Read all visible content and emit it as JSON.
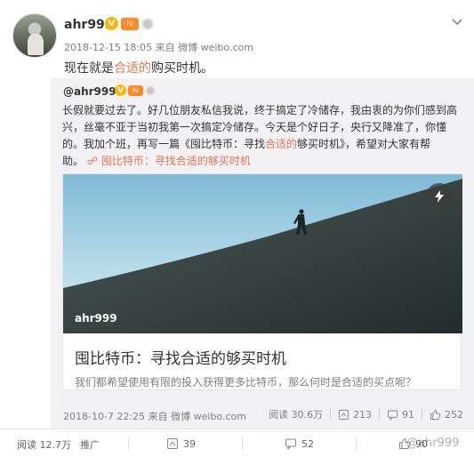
{
  "post": {
    "author": "ahr999",
    "badges": {
      "verified": "V",
      "level": "lv"
    },
    "meta": "2018-12-15 18:05  来自 微博 weibo.com",
    "text_before": "现在就是",
    "text_highlight": "合适的",
    "text_after": "购买时机。"
  },
  "repost": {
    "author": "@ahr999",
    "text_1": "长假就要过去了。好几位朋友私信我说，终于搞定了冷储存，我由衷的为你们感到高兴，丝毫不亚于当初我第一次搞定冷储存。今天是个好日子，央行又降准了，你懂的。我加个班，再写一篇《囤比特币：寻找",
    "text_highlight": "合适的",
    "text_2": "够买时机》，希望对大家有帮助。",
    "link_text": "囤比特币：寻找合适的够买时机",
    "card": {
      "image_username": "ahr999",
      "title": "囤比特币：寻找合适的够买时机",
      "description": "我们都希望使用有限的投入获得更多比特币，那么何时是合适的买点呢？"
    },
    "meta": "2018-10-7 22:25  来自 微博 weibo.com",
    "reads": "阅读 30.6万",
    "reposts": "213",
    "comments": "91",
    "likes": "252"
  },
  "actions": {
    "reads": "阅读 12.7万",
    "promote": "推广",
    "reposts": "39",
    "comments": "52",
    "likes": "90",
    "watermark": "@ahr999"
  },
  "colors": {
    "accent": "#eb7350",
    "repost_bg": "#f2f2f5",
    "sky_top": "#8ec6e0",
    "hill": "#2d3a3a"
  },
  "icons": [
    "chevron-down-icon",
    "flash-icon",
    "repost-icon",
    "comment-icon",
    "like-icon",
    "link-icon"
  ]
}
